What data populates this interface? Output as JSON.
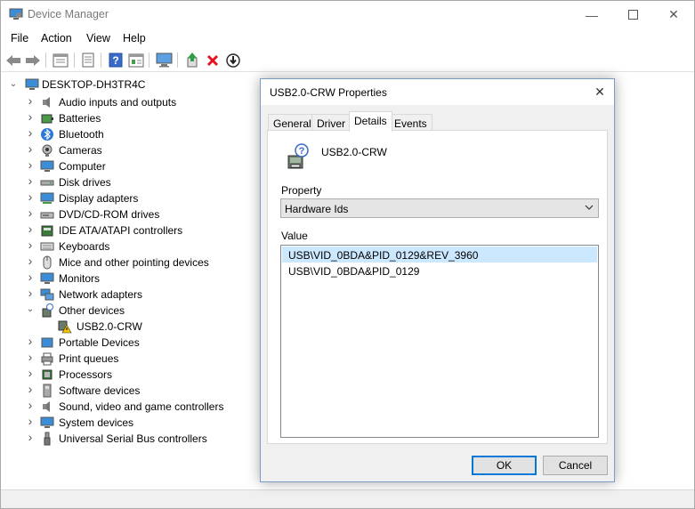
{
  "window": {
    "title": "Device Manager"
  },
  "menu": [
    "File",
    "Action",
    "View",
    "Help"
  ],
  "toolbar": {
    "icons": [
      "back-arrow-icon",
      "forward-arrow-icon",
      "show-hide-tree-icon",
      "properties-icon",
      "help-icon",
      "update-driver-icon",
      "monitor-scan-icon",
      "add-driver-icon",
      "uninstall-x-icon",
      "download-icon"
    ]
  },
  "tree": {
    "root": "DESKTOP-DH3TR4C",
    "items": [
      {
        "label": "Audio inputs and outputs",
        "icon": "speaker-icon",
        "expanded": false
      },
      {
        "label": "Batteries",
        "icon": "battery-icon",
        "expanded": false
      },
      {
        "label": "Bluetooth",
        "icon": "bluetooth-icon",
        "expanded": false
      },
      {
        "label": "Cameras",
        "icon": "camera-icon",
        "expanded": false
      },
      {
        "label": "Computer",
        "icon": "computer-icon",
        "expanded": false
      },
      {
        "label": "Disk drives",
        "icon": "disk-icon",
        "expanded": false
      },
      {
        "label": "Display adapters",
        "icon": "display-icon",
        "expanded": false
      },
      {
        "label": "DVD/CD-ROM drives",
        "icon": "dvd-icon",
        "expanded": false
      },
      {
        "label": "IDE ATA/ATAPI controllers",
        "icon": "ide-icon",
        "expanded": false
      },
      {
        "label": "Keyboards",
        "icon": "keyboard-icon",
        "expanded": false
      },
      {
        "label": "Mice and other pointing devices",
        "icon": "mouse-icon",
        "expanded": false
      },
      {
        "label": "Monitors",
        "icon": "monitor-icon",
        "expanded": false
      },
      {
        "label": "Network adapters",
        "icon": "network-icon",
        "expanded": false
      },
      {
        "label": "Other devices",
        "icon": "unknown-device-icon",
        "expanded": true
      },
      {
        "label": "USB2.0-CRW",
        "icon": "warning-device-icon",
        "child": true
      },
      {
        "label": "Portable Devices",
        "icon": "portable-icon",
        "expanded": false
      },
      {
        "label": "Print queues",
        "icon": "printer-icon",
        "expanded": false
      },
      {
        "label": "Processors",
        "icon": "cpu-icon",
        "expanded": false
      },
      {
        "label": "Software devices",
        "icon": "software-icon",
        "expanded": false
      },
      {
        "label": "Sound, video and game controllers",
        "icon": "sound-icon",
        "expanded": false
      },
      {
        "label": "System devices",
        "icon": "system-icon",
        "expanded": false
      },
      {
        "label": "Universal Serial Bus controllers",
        "icon": "usb-icon",
        "expanded": false
      }
    ]
  },
  "dialog": {
    "title": "USB2.0-CRW Properties",
    "tabs": [
      "General",
      "Driver",
      "Details",
      "Events"
    ],
    "active_tab": "Details",
    "device_name": "USB2.0-CRW",
    "property_label": "Property",
    "property_value": "Hardware Ids",
    "value_label": "Value",
    "values": [
      "USB\\VID_0BDA&PID_0129&REV_3960",
      "USB\\VID_0BDA&PID_0129"
    ],
    "ok": "OK",
    "cancel": "Cancel"
  },
  "colors": {
    "selection": "#cce8ff",
    "accent": "#0078d7",
    "error_red": "#e81123"
  }
}
